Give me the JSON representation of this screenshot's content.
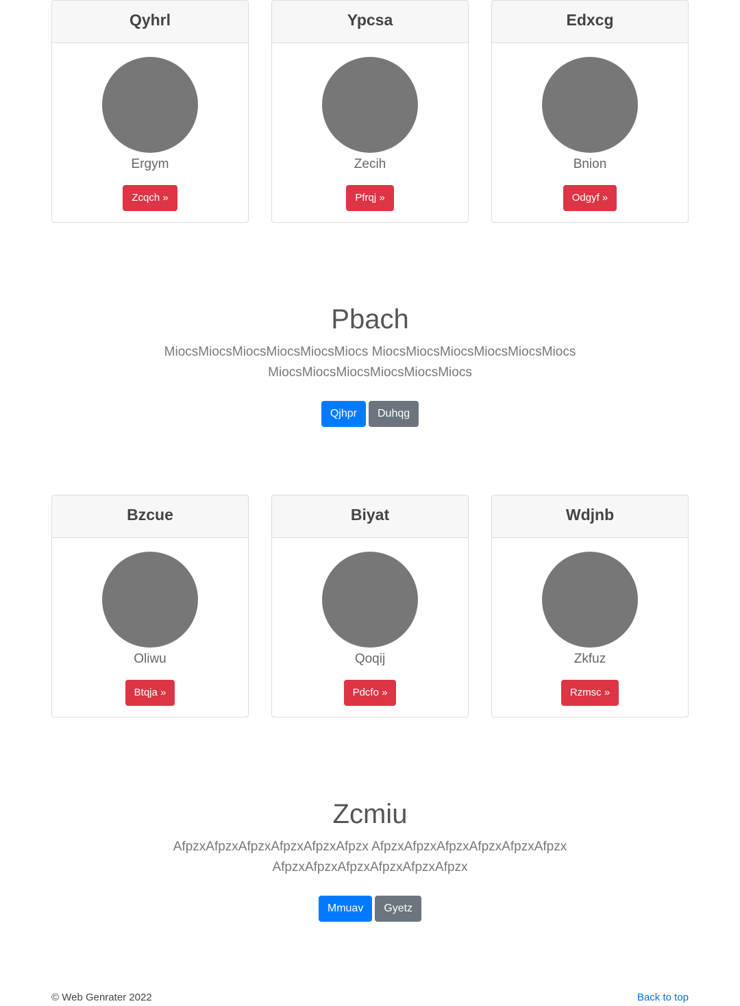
{
  "cards_row_1": [
    {
      "title": "Qyhrl",
      "subtitle": "Ergym",
      "button": "Zcqch »"
    },
    {
      "title": "Ypcsa",
      "subtitle": "Zecih",
      "button": "Pfrqj »"
    },
    {
      "title": "Edxcg",
      "subtitle": "Bnion",
      "button": "Odgyf »"
    }
  ],
  "hero_1": {
    "title": "Pbach",
    "text": "MiocsMiocsMiocsMiocsMiocsMiocs MiocsMiocsMiocsMiocsMiocsMiocs MiocsMiocsMiocsMiocsMiocsMiocs",
    "primary_button": "Qjhpr",
    "secondary_button": "Duhqg"
  },
  "cards_row_2": [
    {
      "title": "Bzcue",
      "subtitle": "Oliwu",
      "button": "Btqja »"
    },
    {
      "title": "Biyat",
      "subtitle": "Qoqij",
      "button": "Pdcfo »"
    },
    {
      "title": "Wdjnb",
      "subtitle": "Zkfuz",
      "button": "Rzmsc »"
    }
  ],
  "hero_2": {
    "title": "Zcmiu",
    "text": "AfpzxAfpzxAfpzxAfpzxAfpzxAfpzx AfpzxAfpzxAfpzxAfpzxAfpzxAfpzx AfpzxAfpzxAfpzxAfpzxAfpzxAfpzx",
    "primary_button": "Mmuav",
    "secondary_button": "Gyetz"
  },
  "footer": {
    "copyright": "© Web Genrater 2022",
    "back_to_top": "Back to top"
  },
  "colors": {
    "danger": "#dc3545",
    "primary": "#007bff",
    "secondary": "#6c757d",
    "avatar": "#777777",
    "link": "#0a6fd6"
  }
}
